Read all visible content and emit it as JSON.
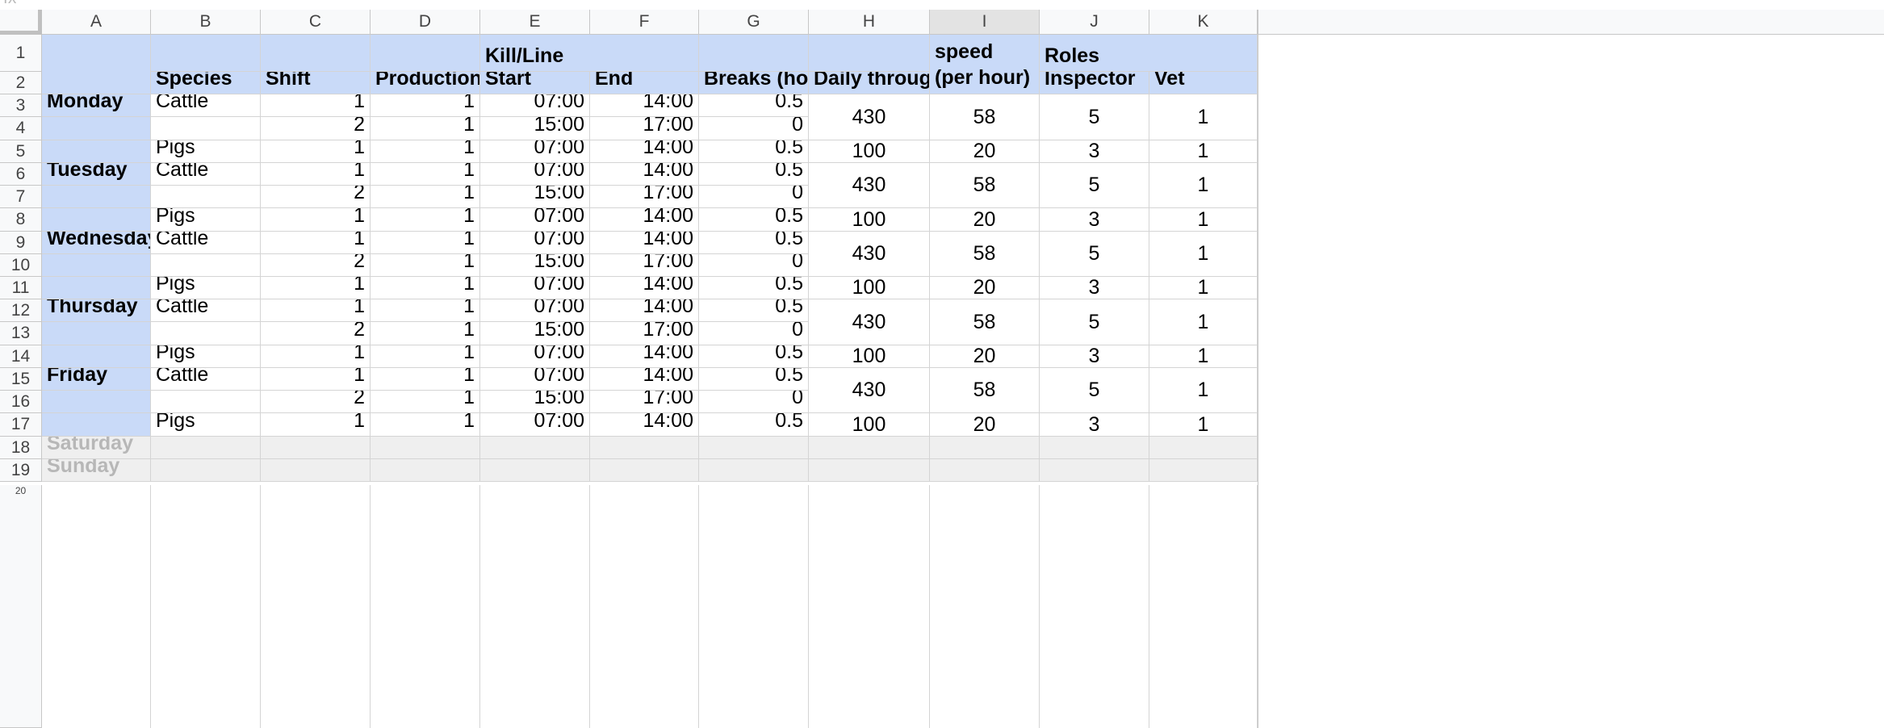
{
  "toolbar_fragment": "fx",
  "columns": [
    "A",
    "B",
    "C",
    "D",
    "E",
    "F",
    "G",
    "H",
    "I",
    "J",
    "K"
  ],
  "selected_column": "I",
  "header_row1": {
    "kill_line": "Kill/Line",
    "estimated": "Estimated max line speed (per hour)",
    "roles": "Roles"
  },
  "header_row2": {
    "species": "Species",
    "shift": "Shift",
    "production_line": "Production line",
    "start": "Start",
    "end": "End",
    "breaks": "Breaks (hours)",
    "daily_throughput": "Daily throughput",
    "inspector": "Inspector",
    "vet": "Vet"
  },
  "rows": [
    {
      "n": "3",
      "day": "Monday",
      "species": "Cattle",
      "shift": "1",
      "line": "1",
      "start": "07:00",
      "end": "14:00",
      "breaks": "0.5"
    },
    {
      "n": "4",
      "day": "",
      "species": "",
      "shift": "2",
      "line": "1",
      "start": "15:00",
      "end": "17:00",
      "breaks": "0"
    },
    {
      "n": "5",
      "day": "",
      "species": "Pigs",
      "shift": "1",
      "line": "1",
      "start": "07:00",
      "end": "14:00",
      "breaks": "0.5"
    },
    {
      "n": "6",
      "day": "Tuesday",
      "species": "Cattle",
      "shift": "1",
      "line": "1",
      "start": "07:00",
      "end": "14:00",
      "breaks": "0.5"
    },
    {
      "n": "7",
      "day": "",
      "species": "",
      "shift": "2",
      "line": "1",
      "start": "15:00",
      "end": "17:00",
      "breaks": "0"
    },
    {
      "n": "8",
      "day": "",
      "species": "Pigs",
      "shift": "1",
      "line": "1",
      "start": "07:00",
      "end": "14:00",
      "breaks": "0.5"
    },
    {
      "n": "9",
      "day": "Wednesday",
      "species": "Cattle",
      "shift": "1",
      "line": "1",
      "start": "07:00",
      "end": "14:00",
      "breaks": "0.5"
    },
    {
      "n": "10",
      "day": "",
      "species": "",
      "shift": "2",
      "line": "1",
      "start": "15:00",
      "end": "17:00",
      "breaks": "0"
    },
    {
      "n": "11",
      "day": "",
      "species": "Pigs",
      "shift": "1",
      "line": "1",
      "start": "07:00",
      "end": "14:00",
      "breaks": "0.5"
    },
    {
      "n": "12",
      "day": "Thursday",
      "species": "Cattle",
      "shift": "1",
      "line": "1",
      "start": "07:00",
      "end": "14:00",
      "breaks": "0.5"
    },
    {
      "n": "13",
      "day": "",
      "species": "",
      "shift": "2",
      "line": "1",
      "start": "15:00",
      "end": "17:00",
      "breaks": "0"
    },
    {
      "n": "14",
      "day": "",
      "species": "Pigs",
      "shift": "1",
      "line": "1",
      "start": "07:00",
      "end": "14:00",
      "breaks": "0.5"
    },
    {
      "n": "15",
      "day": "Friday",
      "species": "Cattle",
      "shift": "1",
      "line": "1",
      "start": "07:00",
      "end": "14:00",
      "breaks": "0.5"
    },
    {
      "n": "16",
      "day": "",
      "species": "",
      "shift": "2",
      "line": "1",
      "start": "15:00",
      "end": "17:00",
      "breaks": "0"
    },
    {
      "n": "17",
      "day": "",
      "species": "Pigs",
      "shift": "1",
      "line": "1",
      "start": "07:00",
      "end": "14:00",
      "breaks": "0.5"
    }
  ],
  "groups": [
    {
      "rows": "3-4",
      "throughput": "430",
      "speed": "58",
      "inspector": "5",
      "vet": "1"
    },
    {
      "rows": "5",
      "throughput": "100",
      "speed": "20",
      "inspector": "3",
      "vet": "1"
    },
    {
      "rows": "6-7",
      "throughput": "430",
      "speed": "58",
      "inspector": "5",
      "vet": "1"
    },
    {
      "rows": "8",
      "throughput": "100",
      "speed": "20",
      "inspector": "3",
      "vet": "1"
    },
    {
      "rows": "9-10",
      "throughput": "430",
      "speed": "58",
      "inspector": "5",
      "vet": "1"
    },
    {
      "rows": "11",
      "throughput": "100",
      "speed": "20",
      "inspector": "3",
      "vet": "1"
    },
    {
      "rows": "12-13",
      "throughput": "430",
      "speed": "58",
      "inspector": "5",
      "vet": "1"
    },
    {
      "rows": "14",
      "throughput": "100",
      "speed": "20",
      "inspector": "3",
      "vet": "1"
    },
    {
      "rows": "15-16",
      "throughput": "430",
      "speed": "58",
      "inspector": "5",
      "vet": "1"
    },
    {
      "rows": "17",
      "throughput": "100",
      "speed": "20",
      "inspector": "3",
      "vet": "1"
    }
  ],
  "weekend": [
    {
      "n": "18",
      "day": "Saturday"
    },
    {
      "n": "19",
      "day": "Sunday"
    }
  ],
  "row_numbers": [
    "1",
    "2"
  ],
  "last_row_number": "20",
  "colors": {
    "header_blue": "#c9daf8",
    "weekend_grey": "#efefef",
    "grid_line": "#d4d4d4"
  }
}
